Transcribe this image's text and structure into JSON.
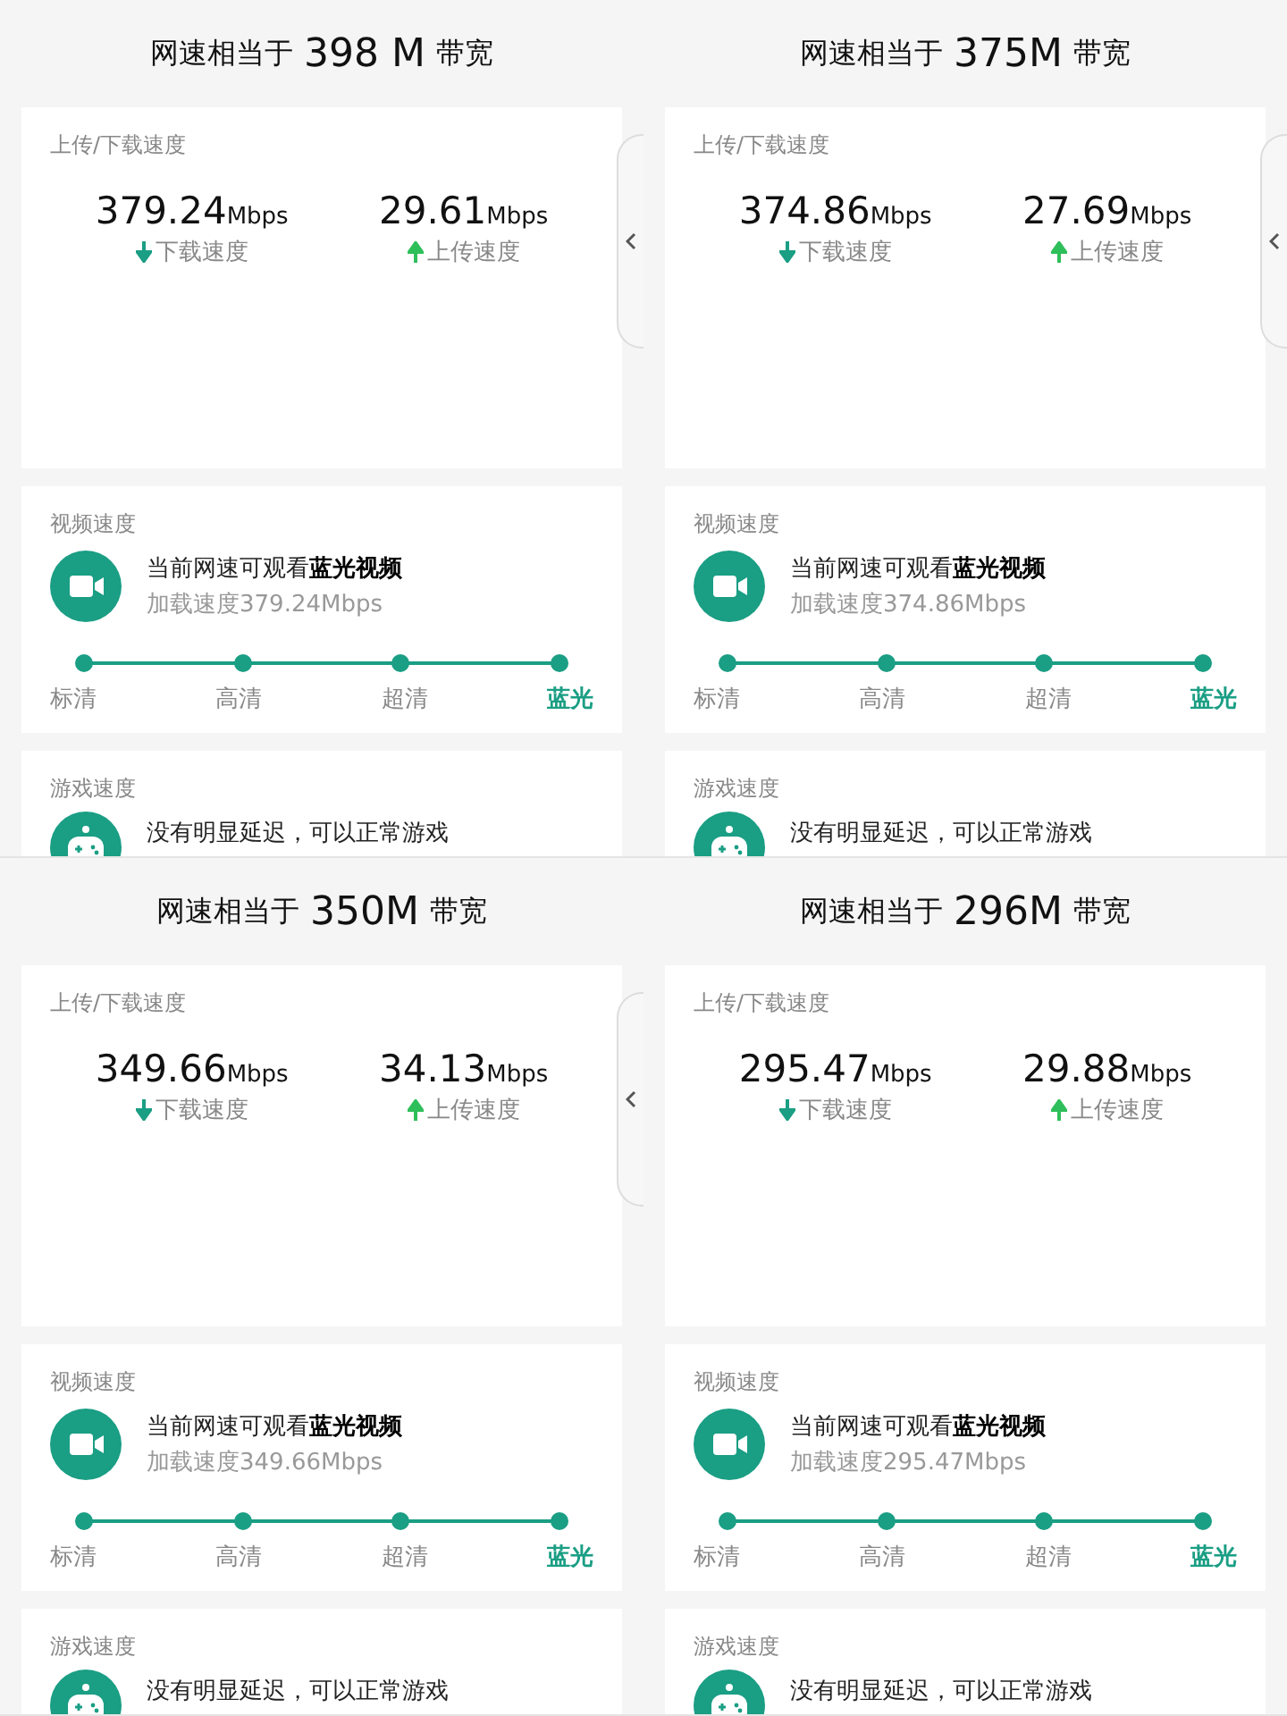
{
  "panels": [
    {
      "title": {
        "prefix": "网速相当于",
        "value": "398 M",
        "suffix": "带宽"
      },
      "handle": true,
      "speed_card": {
        "label": "上传/下载速度",
        "metrics": [
          {
            "kind": "download",
            "value": "379.24",
            "unit": "Mbps",
            "label": "下载速度"
          },
          {
            "kind": "upload",
            "value": "29.61",
            "unit": "Mbps",
            "label": "上传速度"
          }
        ]
      },
      "video_card": {
        "label": "视频速度",
        "headline": "当前网速可观看**蓝光视频**",
        "detail": "加载速度379.24Mbps",
        "stops": [
          {
            "label": "标清",
            "selected": false
          },
          {
            "label": "高清",
            "selected": false
          },
          {
            "label": "超清",
            "selected": false
          },
          {
            "label": "蓝光",
            "selected": true
          }
        ]
      },
      "game_card": {
        "label": "游戏速度",
        "headline": "没有明显延迟，可以正常游戏"
      }
    },
    {
      "title": {
        "prefix": "网速相当于",
        "value": "375M",
        "suffix": "带宽"
      },
      "handle": true,
      "speed_card": {
        "label": "上传/下载速度",
        "metrics": [
          {
            "kind": "download",
            "value": "374.86",
            "unit": "Mbps",
            "label": "下载速度"
          },
          {
            "kind": "upload",
            "value": "27.69",
            "unit": "Mbps",
            "label": "上传速度"
          }
        ]
      },
      "video_card": {
        "label": "视频速度",
        "headline": "当前网速可观看**蓝光视频**",
        "detail": "加载速度374.86Mbps",
        "stops": [
          {
            "label": "标清",
            "selected": false
          },
          {
            "label": "高清",
            "selected": false
          },
          {
            "label": "超清",
            "selected": false
          },
          {
            "label": "蓝光",
            "selected": true
          }
        ]
      },
      "game_card": {
        "label": "游戏速度",
        "headline": "没有明显延迟，可以正常游戏"
      }
    },
    {
      "title": {
        "prefix": "网速相当于",
        "value": "350M",
        "suffix": "带宽"
      },
      "handle": true,
      "speed_card": {
        "label": "上传/下载速度",
        "metrics": [
          {
            "kind": "download",
            "value": "349.66",
            "unit": "Mbps",
            "label": "下载速度"
          },
          {
            "kind": "upload",
            "value": "34.13",
            "unit": "Mbps",
            "label": "上传速度"
          }
        ]
      },
      "video_card": {
        "label": "视频速度",
        "headline": "当前网速可观看**蓝光视频**",
        "detail": "加载速度349.66Mbps",
        "stops": [
          {
            "label": "标清",
            "selected": false
          },
          {
            "label": "高清",
            "selected": false
          },
          {
            "label": "超清",
            "selected": false
          },
          {
            "label": "蓝光",
            "selected": true
          }
        ]
      },
      "game_card": {
        "label": "游戏速度",
        "headline": "没有明显延迟，可以正常游戏"
      }
    },
    {
      "title": {
        "prefix": "网速相当于",
        "value": "296M",
        "suffix": "带宽"
      },
      "handle": false,
      "speed_card": {
        "label": "上传/下载速度",
        "metrics": [
          {
            "kind": "download",
            "value": "295.47",
            "unit": "Mbps",
            "label": "下载速度"
          },
          {
            "kind": "upload",
            "value": "29.88",
            "unit": "Mbps",
            "label": "上传速度"
          }
        ]
      },
      "video_card": {
        "label": "视频速度",
        "headline": "当前网速可观看**蓝光视频**",
        "detail": "加载速度295.47Mbps",
        "stops": [
          {
            "label": "标清",
            "selected": false
          },
          {
            "label": "高清",
            "selected": false
          },
          {
            "label": "超清",
            "selected": false
          },
          {
            "label": "蓝光",
            "selected": true
          }
        ]
      },
      "game_card": {
        "label": "游戏速度",
        "headline": "没有明显延迟，可以正常游戏"
      }
    }
  ]
}
